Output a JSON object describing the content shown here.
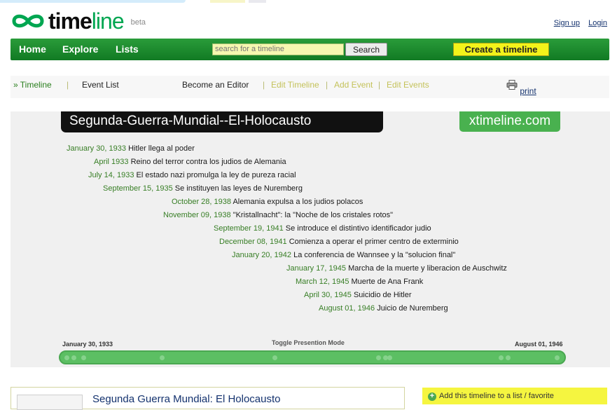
{
  "logo": {
    "word_bold": "time",
    "word_thin": "line",
    "badge": "beta"
  },
  "account": {
    "signup": "Sign up",
    "login": "Login"
  },
  "nav": {
    "home": "Home",
    "explore": "Explore",
    "lists": "Lists",
    "search_placeholder": "search for a timeline",
    "search_button": "Search",
    "create_button": "Create a timeline"
  },
  "subnav": {
    "timeline": "» Timeline",
    "sep1": "|",
    "event_list": "Event List",
    "become_editor": "Become an Editor",
    "sep2": "|",
    "edit_timeline": "Edit Timeline",
    "sep3": "|",
    "add_event": "Add Event",
    "sep4": "|",
    "edit_events": "Edit Events",
    "print": "print"
  },
  "timeline": {
    "title": "Segunda-Guerra-Mundial--El-Holocausto",
    "brand": "xtimeline.com",
    "events": [
      {
        "date": "January 30, 1933",
        "text": "Hitler llega al poder"
      },
      {
        "date": "April 1933",
        "text": "Reino del terror contra los judios de Alemania"
      },
      {
        "date": "July 14, 1933",
        "text": "El estado nazi promulga la ley de pureza racial"
      },
      {
        "date": "September 15, 1935",
        "text": "Se instituyen las leyes de Nuremberg"
      },
      {
        "date": "October 28, 1938",
        "text": "Alemania expulsa a los judios polacos"
      },
      {
        "date": "November 09, 1938",
        "text": "\"Kristallnacht\": la \"Noche de los cristales rotos\""
      },
      {
        "date": "September 19, 1941",
        "text": "Se introduce el distintivo identificador judio"
      },
      {
        "date": "December 08, 1941",
        "text": "Comienza a operar el primer centro de exterminio"
      },
      {
        "date": "January 20, 1942",
        "text": "La conferencia de Wannsee y la \"solucion final\""
      },
      {
        "date": "January 17, 1945",
        "text": "Marcha de la muerte y liberacion de Auschwitz"
      },
      {
        "date": "March 12, 1945",
        "text": "Muerte de Ana Frank"
      },
      {
        "date": "April 30, 1945",
        "text": "Suicidio de Hitler"
      },
      {
        "date": "August 01, 1946",
        "text": "Juicio de Nuremberg"
      }
    ],
    "start_label": "January 30, 1933",
    "end_label": "August 01, 1946",
    "toggle": "Toggle Presention Mode"
  },
  "details": {
    "title": "Segunda Guerra Mundial: El Holocausto"
  },
  "favorite": {
    "label": "Add this timeline to a list / favorite"
  },
  "colors": {
    "nav_green": "#1a8a2c",
    "date_green": "#377e25",
    "brand_green": "#49b14f",
    "create_yellow": "#f3f31a"
  }
}
